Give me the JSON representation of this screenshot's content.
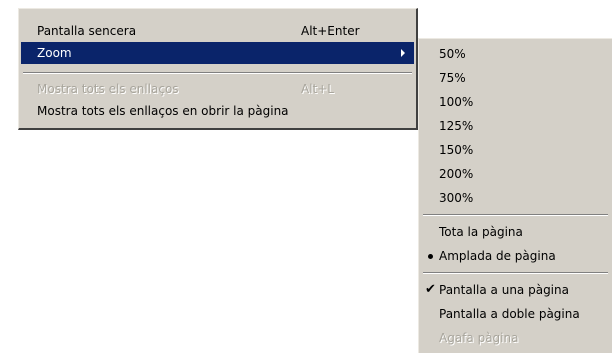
{
  "main_menu": {
    "items": [
      {
        "label": "Pantalla sencera",
        "shortcut": "Alt+Enter"
      },
      {
        "label": "Zoom"
      },
      {
        "label": "Mostra tots els enllaços",
        "shortcut": "Alt+L"
      },
      {
        "label": "Mostra tots els enllaços en obrir la pàgina"
      }
    ]
  },
  "zoom_menu": {
    "levels": [
      "50%",
      "75%",
      "100%",
      "125%",
      "150%",
      "200%",
      "300%"
    ],
    "fit": [
      "Tota la pàgina",
      "Amplada de pàgina"
    ],
    "view": [
      "Pantalla a una pàgina",
      "Pantalla a doble pàgina",
      "Agafa pàgina"
    ],
    "selected_fit": "Amplada de pàgina",
    "checked_view": "Pantalla a una pàgina"
  },
  "colors": {
    "menu_bg": "#d4d0c8",
    "highlight": "#0a246a",
    "disabled_text": "#a8a59c"
  }
}
